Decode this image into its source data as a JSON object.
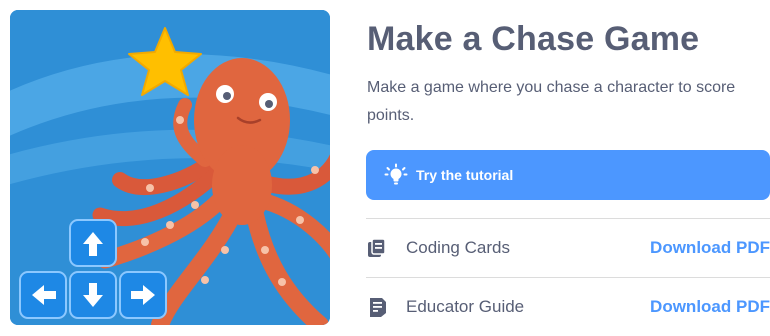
{
  "activity": {
    "title": "Make a Chase Game",
    "description": "Make a game where you chase a character to score points."
  },
  "tutorial_button": {
    "label": "Try the tutorial",
    "icon": "lightbulb-icon"
  },
  "resources": [
    {
      "label": "Coding Cards",
      "icon": "cards-icon",
      "link": "Download PDF"
    },
    {
      "label": "Educator Guide",
      "icon": "guide-icon",
      "link": "Download PDF"
    }
  ],
  "colors": {
    "title_text": "#575e75",
    "accent_blue": "#4c97ff",
    "thumbnail_bg": "#2f8fd6",
    "octopus": "#e0663f",
    "star": "#ffbf00",
    "arrow_keys": "#1e88e5"
  }
}
